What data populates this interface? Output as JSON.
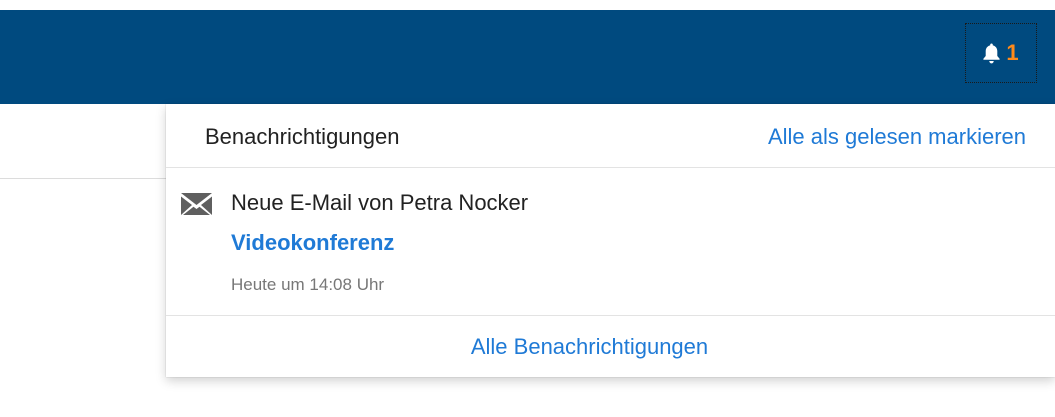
{
  "navbar": {
    "notification_icon": "bell-icon",
    "notification_count": "1",
    "colors": {
      "background": "#004a7f",
      "count": "#ff8a1a",
      "icon": "#ffffff"
    }
  },
  "dropdown": {
    "title": "Benachrichtigungen",
    "mark_all_read": "Alle als gelesen markieren",
    "items": [
      {
        "icon": "envelope-icon",
        "text": "Neue E-Mail von Petra Nocker",
        "subject": "Videokonferenz",
        "time": "Heute um 14:08 Uhr"
      }
    ],
    "footer_link": "Alle Benachrichtigungen",
    "colors": {
      "link": "#1f7ad6",
      "text": "#222222",
      "muted": "#777777"
    }
  }
}
